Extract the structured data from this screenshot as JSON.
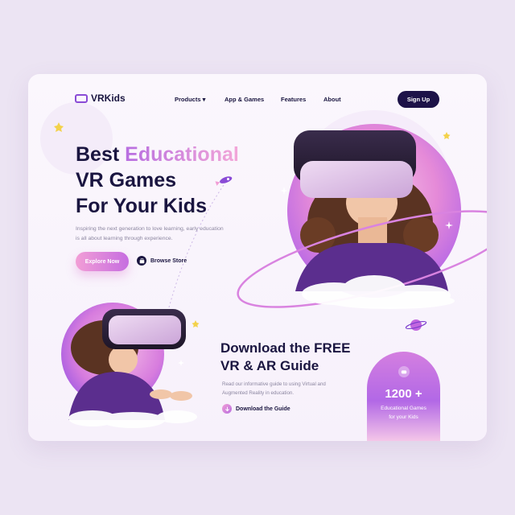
{
  "brand": {
    "name": "VRKids"
  },
  "nav": {
    "items": [
      {
        "label": "Products",
        "has_dropdown": true
      },
      {
        "label": "App & Games"
      },
      {
        "label": "Features"
      },
      {
        "label": "About"
      }
    ],
    "cta": "Sign Up"
  },
  "hero": {
    "title_line1_plain": "Best ",
    "title_line1_accent": "Educational",
    "title_line2": "VR Games",
    "title_line3": "For Your Kids",
    "subtext": "Inspiring the next generation to love learning, early education is all about learning through experience.",
    "primary_cta": "Explore Now",
    "secondary_cta": "Browse Store"
  },
  "download": {
    "title_line1": "Download the FREE",
    "title_line2": "VR & AR Guide",
    "subtext": "Read our informative guide to using Virtual and Augmented Reality in education.",
    "link": "Download the Guide"
  },
  "stat": {
    "value": "1200 +",
    "label_line1": "Educational Games",
    "label_line2": "for your Kids"
  },
  "colors": {
    "background": "#ece4f3",
    "card": "#fbf7fd",
    "navy": "#1d1248",
    "accent_pink": "#f29ed6",
    "accent_purple": "#b86ee0"
  },
  "icons": [
    "vr-headset-logo-icon",
    "chevron-down-icon",
    "store-icon",
    "download-icon",
    "gamepad-icon",
    "rocket-icon",
    "planet-icon",
    "star-icon"
  ]
}
